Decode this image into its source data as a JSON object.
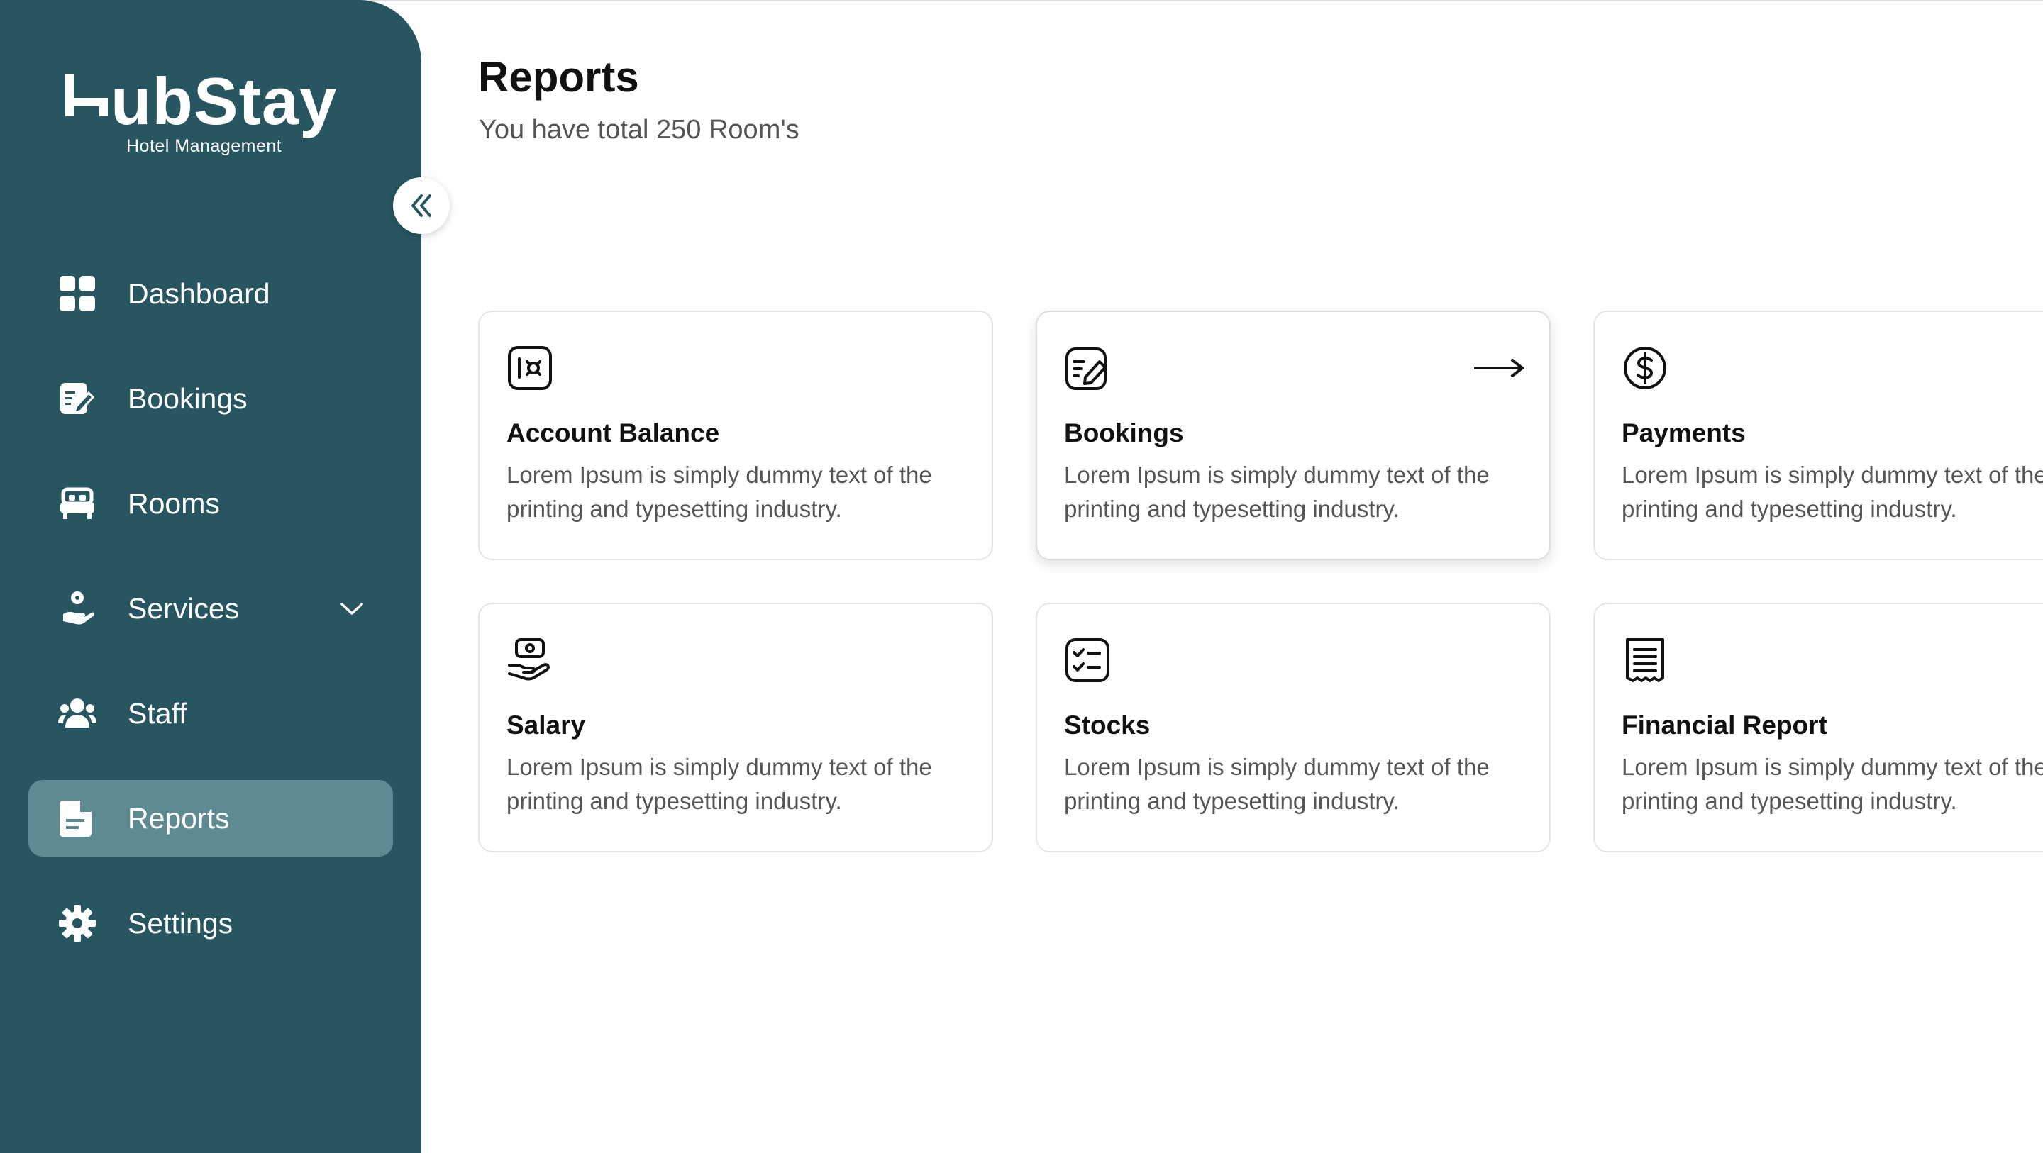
{
  "brand": {
    "name": "ubStay",
    "tagline": "Hotel Management"
  },
  "sidebar": {
    "items": [
      {
        "label": "Dashboard",
        "icon": "dashboard-grid-icon",
        "active": false
      },
      {
        "label": "Bookings",
        "icon": "booking-edit-icon",
        "active": false
      },
      {
        "label": "Rooms",
        "icon": "bed-icon",
        "active": false
      },
      {
        "label": "Services",
        "icon": "service-hand-icon",
        "active": false,
        "has_submenu": true
      },
      {
        "label": "Staff",
        "icon": "staff-group-icon",
        "active": false
      },
      {
        "label": "Reports",
        "icon": "report-document-icon",
        "active": true
      },
      {
        "label": "Settings",
        "icon": "gear-icon",
        "active": false
      }
    ]
  },
  "main": {
    "title": "Reports",
    "subtitle": "You have total 250 Room's"
  },
  "cards": [
    {
      "title": "Account Balance",
      "desc": "Lorem Ipsum is simply dummy text of the printing and typesetting industry.",
      "icon": "safe-icon"
    },
    {
      "title": "Bookings",
      "desc": "Lorem Ipsum is simply dummy text of the printing and typesetting industry.",
      "icon": "booking-edit-icon",
      "hovered": true
    },
    {
      "title": "Payments",
      "desc": "Lorem Ipsum is simply dummy text of the printing and typesetting industry.",
      "icon": "dollar-circle-icon"
    },
    {
      "title": "Salary",
      "desc": "Lorem Ipsum is simply dummy text of the printing and typesetting industry.",
      "icon": "salary-hand-icon"
    },
    {
      "title": "Stocks",
      "desc": "Lorem Ipsum is simply dummy text of the printing and typesetting industry.",
      "icon": "checklist-icon"
    },
    {
      "title": "Financial Report",
      "desc": "Lorem Ipsum is simply dummy text of the printing and typesetting industry.",
      "icon": "receipt-icon"
    }
  ],
  "colors": {
    "sidebar_bg": "#275660",
    "active_item_bg": "#5e8b92",
    "text_dark": "#111111",
    "text_muted": "#555555"
  }
}
